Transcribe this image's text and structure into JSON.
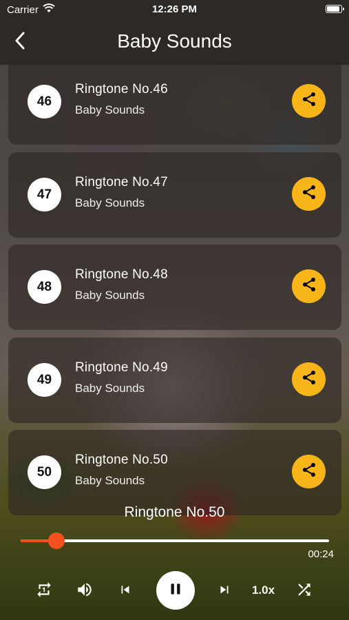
{
  "status": {
    "carrier": "Carrier",
    "time": "12:26 PM"
  },
  "nav": {
    "title": "Baby Sounds"
  },
  "items": [
    {
      "num": "46",
      "title": "Ringtone No.46",
      "subtitle": "Baby Sounds"
    },
    {
      "num": "47",
      "title": "Ringtone No.47",
      "subtitle": "Baby Sounds"
    },
    {
      "num": "48",
      "title": "Ringtone No.48",
      "subtitle": "Baby Sounds"
    },
    {
      "num": "49",
      "title": "Ringtone No.49",
      "subtitle": "Baby Sounds"
    },
    {
      "num": "50",
      "title": "Ringtone No.50",
      "subtitle": "Baby Sounds"
    }
  ],
  "player": {
    "now_playing": "Ringtone No.50",
    "elapsed": "00:24",
    "progress": 0.115,
    "speed": "1.0x",
    "accent_color": "#f4511e"
  },
  "colors": {
    "share_button": "#f7b519"
  },
  "icons": {
    "back": "chevron-left-icon",
    "share": "share-icon",
    "repeat": "repeat-one-icon",
    "volume": "volume-icon",
    "previous": "skip-previous-icon",
    "pause": "pause-icon",
    "next": "skip-next-icon",
    "shuffle": "shuffle-icon"
  }
}
